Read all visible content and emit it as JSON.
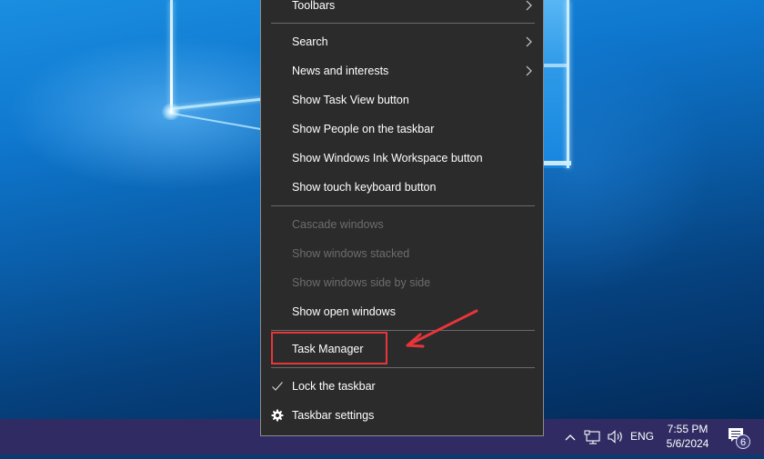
{
  "context_menu": {
    "items": [
      {
        "label": "Toolbars",
        "submenu": true,
        "enabled": true
      },
      {
        "label": "Search",
        "submenu": true,
        "enabled": true
      },
      {
        "label": "News and interests",
        "submenu": true,
        "enabled": true
      },
      {
        "label": "Show Task View button",
        "enabled": true
      },
      {
        "label": "Show People on the taskbar",
        "enabled": true
      },
      {
        "label": "Show Windows Ink Workspace button",
        "enabled": true
      },
      {
        "label": "Show touch keyboard button",
        "enabled": true
      },
      {
        "label": "Cascade windows",
        "enabled": false
      },
      {
        "label": "Show windows stacked",
        "enabled": false
      },
      {
        "label": "Show windows side by side",
        "enabled": false
      },
      {
        "label": "Show open windows",
        "enabled": true
      },
      {
        "label": "Task Manager",
        "enabled": true,
        "highlighted": true
      },
      {
        "label": "Lock the taskbar",
        "enabled": true,
        "checked": true,
        "icon": "checkmark-icon"
      },
      {
        "label": "Taskbar settings",
        "enabled": true,
        "icon": "gear-icon"
      }
    ]
  },
  "annotation": {
    "highlight_color": "#e8353a",
    "target": "Task Manager"
  },
  "taskbar": {
    "color": "#302c63",
    "tray": {
      "show_hidden_icon": "chevron-up-icon",
      "network_icon": "network-icon",
      "volume_icon": "volume-icon",
      "language": "ENG"
    },
    "clock": {
      "time": "7:55 PM",
      "date": "5/6/2024"
    },
    "notifications": {
      "icon": "action-center-icon",
      "count": "6"
    }
  }
}
